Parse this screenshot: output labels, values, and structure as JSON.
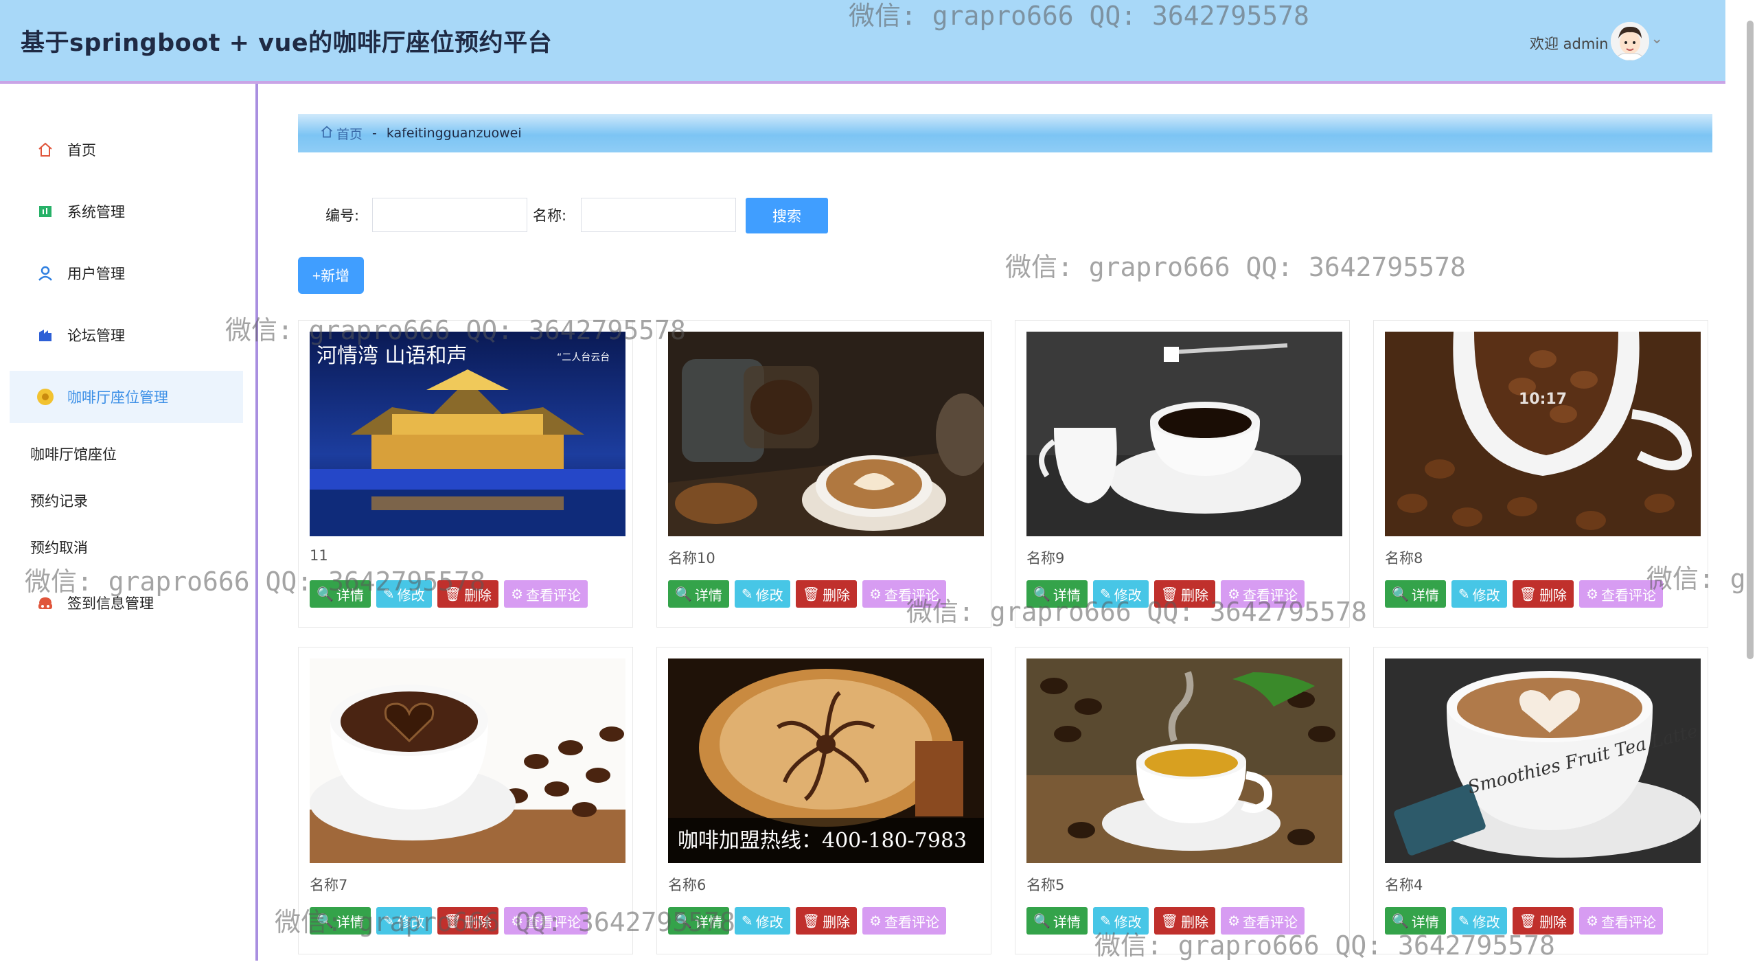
{
  "header": {
    "title": "基于springboot + vue的咖啡厅座位预约平台",
    "welcome": "欢迎 admin"
  },
  "sidebar": {
    "items": [
      {
        "label": "首页",
        "icon": "home-icon"
      },
      {
        "label": "系统管理",
        "icon": "system-icon"
      },
      {
        "label": "用户管理",
        "icon": "user-icon"
      },
      {
        "label": "论坛管理",
        "icon": "forum-icon"
      },
      {
        "label": "咖啡厅座位管理",
        "icon": "coffee-icon",
        "active": true
      }
    ],
    "sub_items": [
      "咖啡厅馆座位",
      "预约记录",
      "预约取消"
    ],
    "last_item": {
      "label": "签到信息管理",
      "icon": "checkin-icon"
    }
  },
  "breadcrumb": {
    "home": "首页",
    "separator": "-",
    "current": "kafeitingguanzuowei"
  },
  "search": {
    "field1_label": "编号:",
    "field2_label": "名称:",
    "field1_value": "",
    "field2_value": "",
    "button": "搜索"
  },
  "add_button": "+新增",
  "actions": {
    "detail": "详情",
    "edit": "修改",
    "delete": "删除",
    "review": "查看评论"
  },
  "cards": [
    {
      "name": "11",
      "image": "night-palace"
    },
    {
      "name": "名称10",
      "image": "latte-beans-jar"
    },
    {
      "name": "名称9",
      "image": "cup-spoon-sugar"
    },
    {
      "name": "名称8",
      "image": "cup-full-of-beans"
    },
    {
      "name": "名称7",
      "image": "heart-coffee-beans"
    },
    {
      "name": "名称6",
      "image": "cappuccino-hotline",
      "overlay_text": "咖啡加盟热线：400-180-7983"
    },
    {
      "name": "名称5",
      "image": "espresso-steam-beans"
    },
    {
      "name": "名称4",
      "image": "latte-art-cup"
    }
  ],
  "image_text": {
    "palace_caption": "河情湾 山语和声",
    "palace_tag": "“二人台云台",
    "mug_brand": "Smoothies Fruit Tea Latte Mocha"
  },
  "watermark": "微信: grapro666 QQ: 3642795578",
  "colors": {
    "header_bg": "#a8d8f8",
    "primary": "#409eff",
    "detail": "#34a34a",
    "edit": "#47c6e6",
    "delete": "#c0302c",
    "review": "#d79cf2"
  }
}
